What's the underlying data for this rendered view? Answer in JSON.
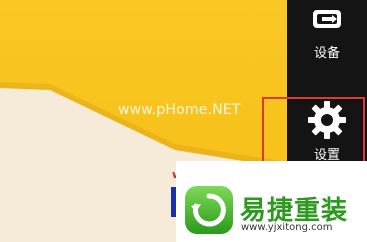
{
  "wallpaper": {
    "watermark_text": "www.pHome.NET"
  },
  "charms": {
    "devices": {
      "label": "设备",
      "icon": "devices-icon"
    },
    "settings": {
      "label": "设置",
      "icon": "gear-icon",
      "highlighted": true
    }
  },
  "overlay": {
    "left_fragment": "w",
    "brand_name": "易捷重装",
    "brand_url": "www.yjxitong.com",
    "brand_color": "#2d9a1f"
  },
  "colors": {
    "wallpaper_yellow": "#f9c823",
    "wallpaper_light": "#f6ead8",
    "charms_bg": "#141414",
    "highlight_red": "#e03a2a"
  }
}
